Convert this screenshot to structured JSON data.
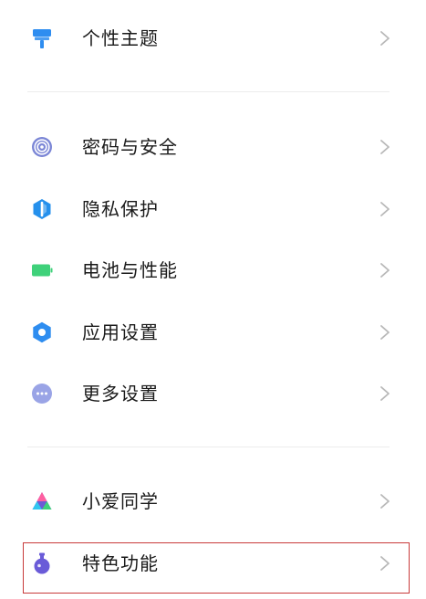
{
  "colors": {
    "highlight_border": "#c83a3a",
    "chevron": "#b8b8b8",
    "divider": "#ececec"
  },
  "menu_groups": [
    {
      "items": [
        {
          "label": "个性主题",
          "icon": "paint-roller-icon",
          "icon_color": "#2e8df0"
        }
      ]
    },
    {
      "items": [
        {
          "label": "密码与安全",
          "icon": "fingerprint-icon",
          "icon_color": "#7b86d6"
        },
        {
          "label": "隐私保护",
          "icon": "privacy-shield-icon",
          "icon_color": "#2590ec"
        },
        {
          "label": "电池与性能",
          "icon": "battery-icon",
          "icon_color": "#3fd17a"
        },
        {
          "label": "应用设置",
          "icon": "gear-icon",
          "icon_color": "#2e8df0"
        },
        {
          "label": "更多设置",
          "icon": "more-dots-icon",
          "icon_color": "#9aa4e6"
        }
      ]
    },
    {
      "items": [
        {
          "label": "小爱同学",
          "icon": "xiaoai-icon",
          "icon_color": "#6b5bd6"
        },
        {
          "label": "特色功能",
          "icon": "flask-icon",
          "icon_color": "#6a5bd8",
          "highlighted": true
        }
      ]
    }
  ]
}
